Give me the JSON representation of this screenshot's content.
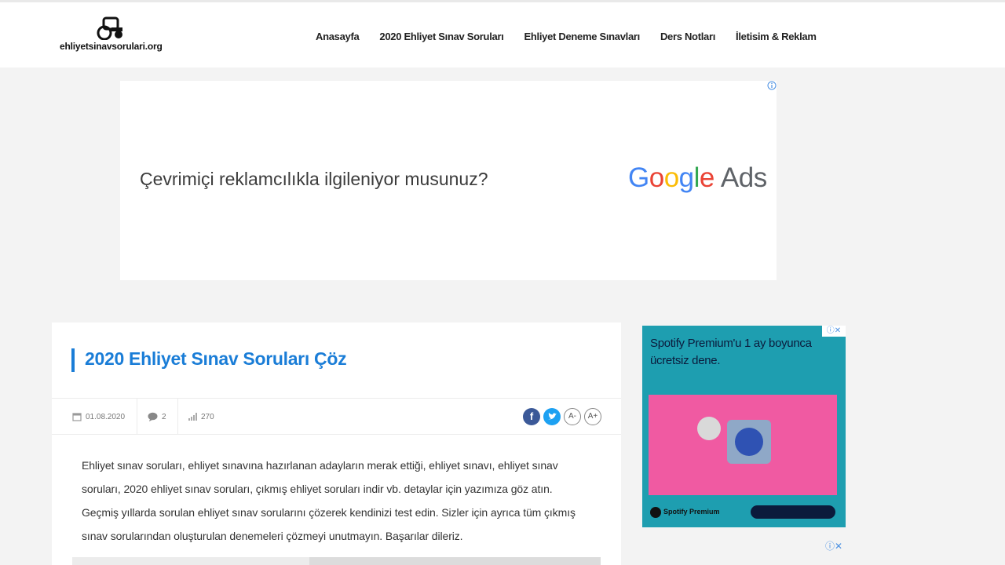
{
  "header": {
    "logo_text": "ehliyetsinavsorulari.org",
    "nav": [
      "Anasayfa",
      "2020 Ehliyet Sınav Soruları",
      "Ehliyet Deneme Sınavları",
      "Ders Notları",
      "İletisim & Reklam"
    ]
  },
  "ad_banner": {
    "text": "Çevrimiçi reklamcılıkla ilgileniyor musunuz?",
    "brand_ads": "Ads",
    "info_icon": "info-icon"
  },
  "article": {
    "title": "2020 Ehliyet Sınav Soruları Çöz",
    "meta": {
      "date": "01.08.2020",
      "comments": "2",
      "views": "270"
    },
    "share": {
      "facebook": "f",
      "font_minus": "A-",
      "font_plus": "A+"
    },
    "body": [
      "Ehliyet sınav soruları, ehliyet sınavına hazırlanan adayların merak ettiği, ehliyet sınavı, ehliyet sınav soruları, 2020 ehliyet sınav soruları, çıkmış ehliyet soruları indir vb. detaylar için yazımıza göz atın. Geçmiş yıllarda sorulan ehliyet sınav sorularını çözerek kendinizi test edin. Sizler için ayrıca tüm çıkmış sınav sorularından oluşturulan denemeleri çözmeyi unutmayın. Başarılar dileriz."
    ]
  },
  "side_ad": {
    "headline": "Spotify Premium'u 1 ay boyunca ücretsiz dene.",
    "brand": "Spotify Premium",
    "close": "ⓘ✕"
  },
  "colors": {
    "accent": "#1a7dd7",
    "facebook": "#3b5998",
    "twitter": "#1da1f2",
    "spotify_bg": "#1e9eb0",
    "spotify_image": "#f05aa2"
  }
}
